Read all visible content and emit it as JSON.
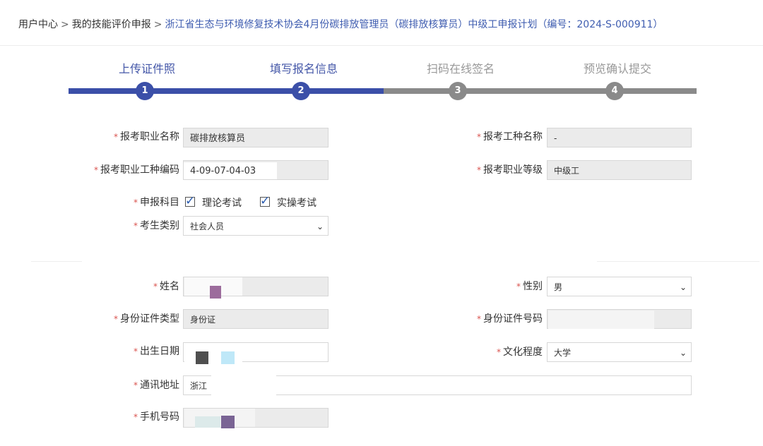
{
  "breadcrumb": {
    "home": "用户中心",
    "sep": ">",
    "mine": "我的技能评价申报",
    "current": "浙江省生态与环境修复技术协会4月份碳排放管理员（碳排放核算员）中级工申报计划（编号：2024-S-000911）"
  },
  "steps": [
    {
      "num": "1",
      "label": "上传证件照",
      "state": "done"
    },
    {
      "num": "2",
      "label": "填写报名信息",
      "state": "done"
    },
    {
      "num": "3",
      "label": "扫码在线签名",
      "state": "todo"
    },
    {
      "num": "4",
      "label": "预览确认提交",
      "state": "todo"
    }
  ],
  "colors": {
    "accent": "#3b4fa8",
    "inactive": "#8a8a8a",
    "required": "#d9534f",
    "link": "#3f5db0"
  },
  "form": {
    "required_mark": "*",
    "occupation_name": {
      "label": "报考职业名称",
      "value": "碳排放核算员"
    },
    "job_type_name": {
      "label": "报考工种名称",
      "value": "-"
    },
    "occupation_code": {
      "label": "报考职业工种编码",
      "value": "4-09-07-04-03"
    },
    "occupation_level": {
      "label": "报考职业等级",
      "value": "中级工"
    },
    "subjects": {
      "label": "申报科目",
      "theory": "理论考试",
      "practical": "实操考试",
      "theory_checked": true,
      "practical_checked": true
    },
    "candidate_type": {
      "label": "考生类别",
      "value": "社会人员"
    },
    "name": {
      "label": "姓名",
      "value": ""
    },
    "gender": {
      "label": "性别",
      "value": "男"
    },
    "id_type": {
      "label": "身份证件类型",
      "value": "身份证"
    },
    "id_number": {
      "label": "身份证件号码",
      "value": ""
    },
    "birth_date": {
      "label": "出生日期",
      "value": ""
    },
    "education": {
      "label": "文化程度",
      "value": "大学"
    },
    "address": {
      "label": "通讯地址",
      "value": "浙江"
    },
    "phone": {
      "label": "手机号码",
      "value": ""
    }
  },
  "icons": {
    "checkbox": "checkbox-checked-icon",
    "dropdown": "chevron-down-icon"
  }
}
